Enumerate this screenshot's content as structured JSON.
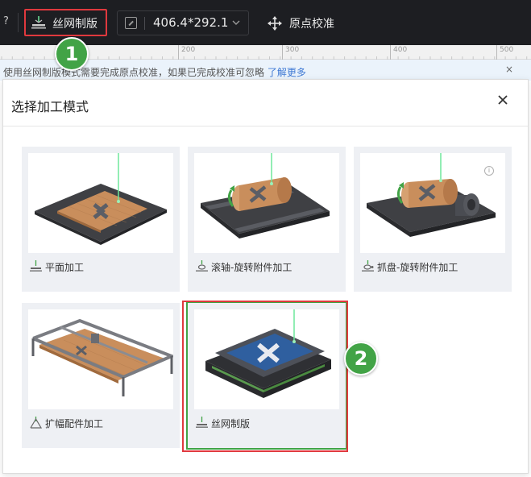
{
  "toolbar": {
    "mode_icon": "screen-print-icon",
    "mode_label": "丝网制版",
    "size_icon": "resize-icon",
    "size_value": "406.4*292.1",
    "size_dropdown_icon": "chevron-down-icon",
    "origin_icon": "move-cross-icon",
    "origin_label": "原点校准"
  },
  "ruler": {
    "labels": [
      "200",
      "300",
      "400",
      "500"
    ]
  },
  "notice": {
    "text": "使用丝网制版模式需要完成原点校准，如果已完成校准可忽略",
    "link": "了解更多",
    "close": "×"
  },
  "badges": {
    "step1": "1",
    "step2": "2"
  },
  "dialog": {
    "title": "选择加工模式",
    "close_icon": "close-icon",
    "modes": [
      {
        "label": "平面加工",
        "icon": "flat-laser-icon",
        "selected": false
      },
      {
        "label": "滚轴-旋转附件加工",
        "icon": "roller-rotary-icon",
        "selected": false
      },
      {
        "label": "抓盘-旋转附件加工",
        "icon": "chuck-rotary-icon",
        "selected": false,
        "info_icon": "info-icon"
      },
      {
        "label": "扩幅配件加工",
        "icon": "extension-kit-icon",
        "selected": false
      },
      {
        "label": "丝网制版",
        "icon": "screen-print-icon",
        "selected": true
      }
    ]
  },
  "colors": {
    "toolbar_bg": "#1d1e22",
    "highlight_red": "#e0393e",
    "badge_green": "#42a346",
    "laser_green": "#6ee79a",
    "card_bg": "#eef0f4",
    "link_blue": "#3f79d4"
  }
}
